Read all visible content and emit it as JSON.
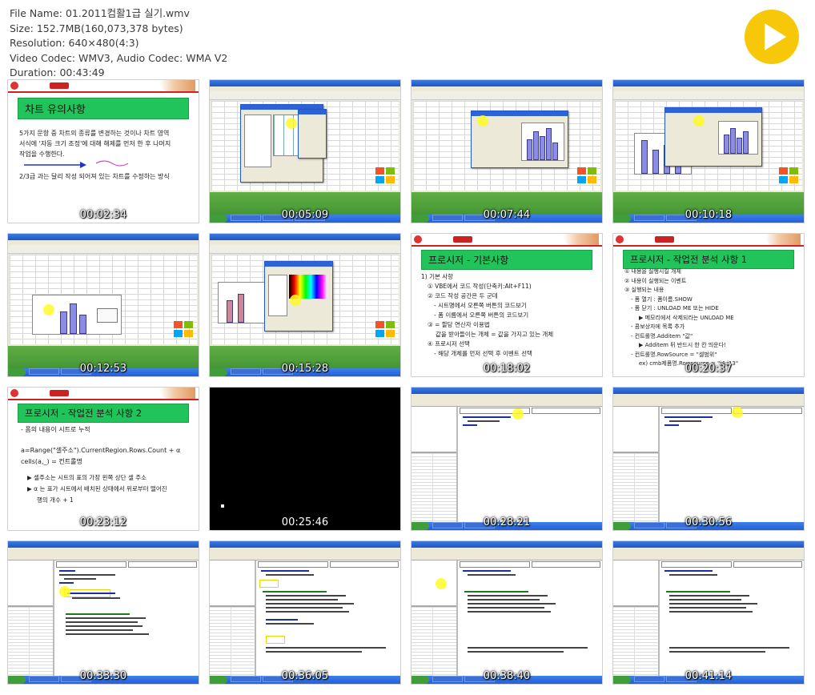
{
  "file_info": {
    "file_name": "File Name: 01.2011컴활1급 실기.wmv",
    "size": "Size: 152.7MB(160,073,378 bytes)",
    "resolution": "Resolution: 640×480(4:3)",
    "video_codec": "Video Codec: WMV3, Audio Codec: WMA V2",
    "duration": "Duration: 00:43:49"
  },
  "play_button": {
    "icon": "play-icon",
    "color": "#f7c70a"
  },
  "thumbnails": [
    {
      "time": "00:02:34",
      "type": "slide",
      "title": "차트 유의사항",
      "lines": [
        "5가지 문항 중 차트의 종류를 변경하는 것이나 차트 영역",
        "서식에 '자동 크기 조정'에 대해 해제를 먼저 한 후 나머지",
        "작업을 수행한다.",
        "2/3급 과는 달리 작성 되어져 있는 차트를 수정하는 방식"
      ]
    },
    {
      "time": "00:05:09",
      "type": "desktop"
    },
    {
      "time": "00:07:44",
      "type": "desktop"
    },
    {
      "time": "00:10:18",
      "type": "desktop"
    },
    {
      "time": "00:12:53",
      "type": "desktop"
    },
    {
      "time": "00:15:28",
      "type": "desktop"
    },
    {
      "time": "00:18:02",
      "type": "slide",
      "title": "프로시저 - 기본사항",
      "lines": [
        "1) 기본 사항",
        "① VBE에서 코드 작성(단축키:Alt+F11)",
        "② 코드 작성 공간은 두 군데",
        "- 시트명에서 오른쪽 버튼의 코드보기",
        "- 폼 이름에서 오른쪽 버튼의 코드보기",
        "③ = 할당 연산자 이용법",
        "값을 받아들이는 개체 = 값을 가지고 있는 개체",
        "④ 프로시저 선택",
        "- 해당 개체를 먼저 선택 후 이벤트 선택"
      ]
    },
    {
      "time": "00:20:37",
      "type": "slide",
      "title": "프로시저 - 작업전 분석 사항 1",
      "lines": [
        "① 내용을 실행시킬 개체",
        "② 내용이 실행되는 이벤트",
        "③ 실행되는 내용",
        "- 폼 열기 : 폼이름.SHOW",
        "- 폼 닫기 : UNLOAD ME 또는 HIDE",
        "▶ 메모리에서 삭제되라는 UNLOAD ME",
        "- 콤보상자에 목록 추가",
        "- 컨트롤명.Additem \"값\"",
        "▶ Additem 뒤 반드시 한 칸 띄운다!",
        "- 컨트롤명.RowSource = \"셀범위\"",
        "ex) cmb제품명.Rowsource = \"i4:j13\""
      ]
    },
    {
      "time": "00:23:12",
      "type": "slide",
      "title": "프로시저 - 작업전 분석 사항 2",
      "lines": [
        "- 폼의 내용이 시트로 누적",
        "a=Range(\"셀주소\").CurrentRegion.Rows.Count + α",
        "cells(a,_) = 컨트롤명",
        "▶ 셀주소는 시트의 표의 가장 왼쪽 상단 셀 주소",
        "▶ α 는 표가 시트에서 배치된 상태에서 위로부터 떨어진",
        "행의 개수 + 1"
      ]
    },
    {
      "time": "00:25:46",
      "type": "black"
    },
    {
      "time": "00:28:21",
      "type": "vb"
    },
    {
      "time": "00:30:56",
      "type": "vb"
    },
    {
      "time": "00:33:30",
      "type": "vb"
    },
    {
      "time": "00:36:05",
      "type": "vb"
    },
    {
      "time": "00:38:40",
      "type": "vb"
    },
    {
      "time": "00:41:14",
      "type": "vb"
    }
  ]
}
